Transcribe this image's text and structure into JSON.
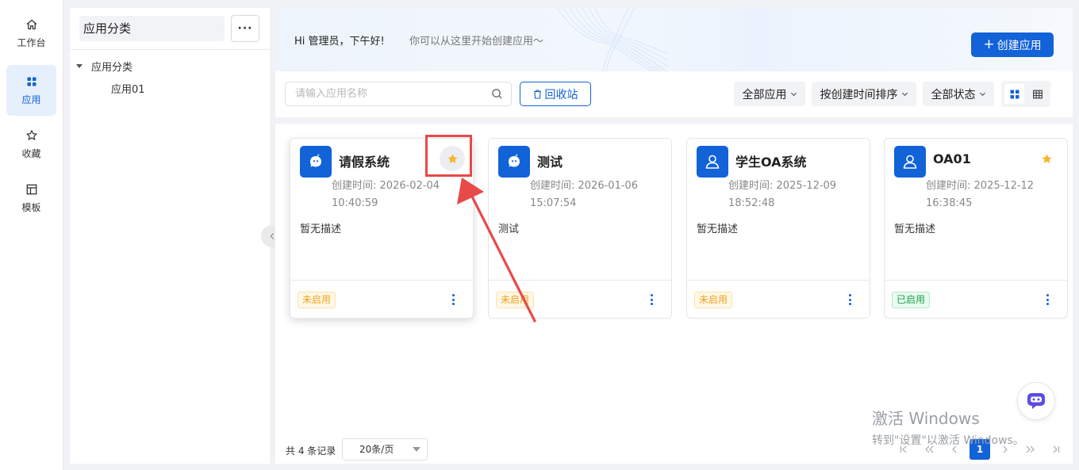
{
  "nav": {
    "items": [
      {
        "label": "工作台",
        "icon": "home-icon",
        "active": false
      },
      {
        "label": "应用",
        "icon": "grid-apps-icon",
        "active": true
      },
      {
        "label": "收藏",
        "icon": "star-outline-icon",
        "active": false
      },
      {
        "label": "模板",
        "icon": "template-icon",
        "active": false
      }
    ]
  },
  "category": {
    "title": "应用分类",
    "more_label": "···",
    "tree": {
      "root": "应用分类",
      "children": [
        "应用01"
      ]
    }
  },
  "banner": {
    "greeting": "Hi 管理员，下午好!",
    "subtitle": "你可以从这里开始创建应用～",
    "create_label": "创建应用",
    "create_plus": "+"
  },
  "toolbar": {
    "search_placeholder": "请输入应用名称",
    "recycle_label": "回收站",
    "filter_app": "全部应用",
    "sort": "按创建时间排序",
    "status": "全部状态"
  },
  "cards": [
    {
      "name": "请假系统",
      "icon": "robot-icon",
      "time_label": "创建时间:",
      "date": "2026-02-04",
      "time": "10:40:59",
      "desc": "暂无描述",
      "status": "未启用",
      "status_type": "off",
      "favorited": true
    },
    {
      "name": "测试",
      "icon": "robot-icon",
      "time_label": "创建时间:",
      "date": "2026-01-06",
      "time": "15:07:54",
      "desc": "测试",
      "status": "未启用",
      "status_type": "off",
      "favorited": false
    },
    {
      "name": "学生OA系统",
      "icon": "user-icon",
      "time_label": "创建时间:",
      "date": "2025-12-09",
      "time": "18:52:48",
      "desc": "暂无描述",
      "status": "未启用",
      "status_type": "off",
      "favorited": false
    },
    {
      "name": "OA01",
      "icon": "user-icon",
      "time_label": "创建时间:",
      "date": "2025-12-12",
      "time": "16:38:45",
      "desc": "暂无描述",
      "status": "已启用",
      "status_type": "on",
      "favorited": true
    }
  ],
  "footer": {
    "total": "共 4 条记录",
    "page_size": "20条/页",
    "current_page": "1"
  },
  "watermark": {
    "title": "激活 Windows",
    "subtitle": "转到\"设置\"以激活 Windows。"
  },
  "colors": {
    "primary": "#1262d8",
    "star": "#f7b52c",
    "annotation": "#e84949"
  }
}
